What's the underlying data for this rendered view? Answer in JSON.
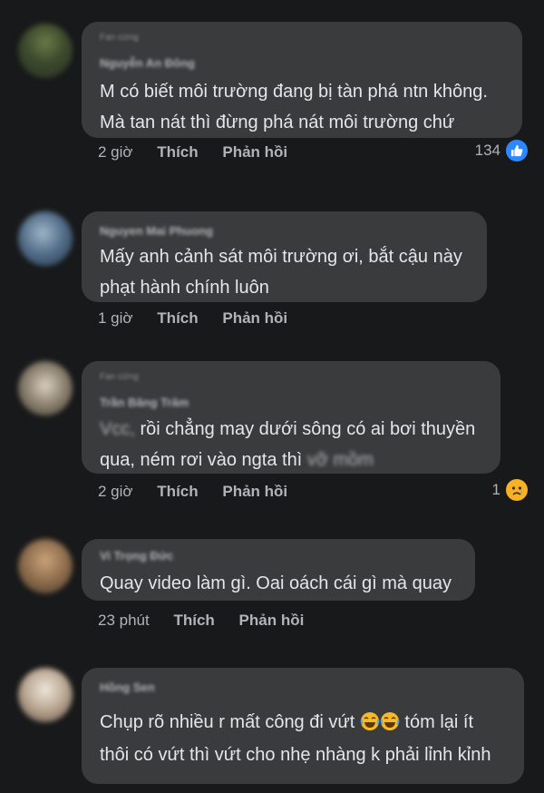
{
  "comments": [
    {
      "badge": "Fan cứng",
      "author": "Nguyễn An Đông",
      "text_lines": [
        "M có biết môi trường đang bị tàn phá ntn không.",
        "Mà tan nát thì đừng phá nát môi trường chứ"
      ],
      "time": "2 giờ",
      "like_label": "Thích",
      "reply_label": "Phản hồi",
      "reaction_count": "134",
      "reaction_icon": "like-icon"
    },
    {
      "badge": "",
      "author": "Nguyen Mai Phuong",
      "text_lines": [
        "Mấy anh cảnh sát môi trường ơi, bắt cậu này",
        "phạt hành chính luôn"
      ],
      "time": "1 giờ",
      "like_label": "Thích",
      "reply_label": "Phản hồi"
    },
    {
      "badge": "Fan cứng",
      "author": "Trần Băng Trâm",
      "text_prefix": "Vcc,",
      "text_line1_rest": " rồi chẳng may dưới sông có ai bơi thuyền",
      "text_line2_main": "qua, ném rơi vào ngta thì ",
      "text_line2_blurred": "vỡ mồm",
      "time": "2 giờ",
      "like_label": "Thích",
      "reply_label": "Phản hồi",
      "reaction_count": "1",
      "reaction_icon": "sad-icon"
    },
    {
      "badge": "",
      "author": "Vi Trọng Đức",
      "text_lines": [
        "Quay video làm gì. Oai oách cái gì mà quay"
      ],
      "time": "23 phút",
      "like_label": "Thích",
      "reply_label": "Phản hồi"
    },
    {
      "badge": "",
      "author": "Hồng Sen",
      "text_line1_before": "Chụp rõ nhiều r mất công đi vứt ",
      "text_line1_after": " tóm lại ít",
      "text_line2": "thôi có vứt thì vứt cho nhẹ nhàng k phải lỉnh kỉnh",
      "emoji": "laughing-tears-emoji"
    }
  ],
  "colors": {
    "background": "#18191a",
    "bubble": "#3a3b3c",
    "text": "#e4e6eb",
    "secondary": "#b0b3b8",
    "like_blue": "#2d88ff"
  }
}
